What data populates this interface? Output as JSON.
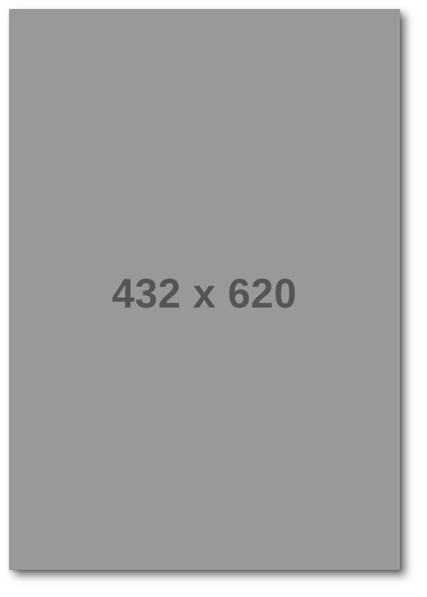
{
  "placeholder": {
    "label": "432 x 620",
    "background_color": "#999999",
    "text_color": "#555555"
  }
}
